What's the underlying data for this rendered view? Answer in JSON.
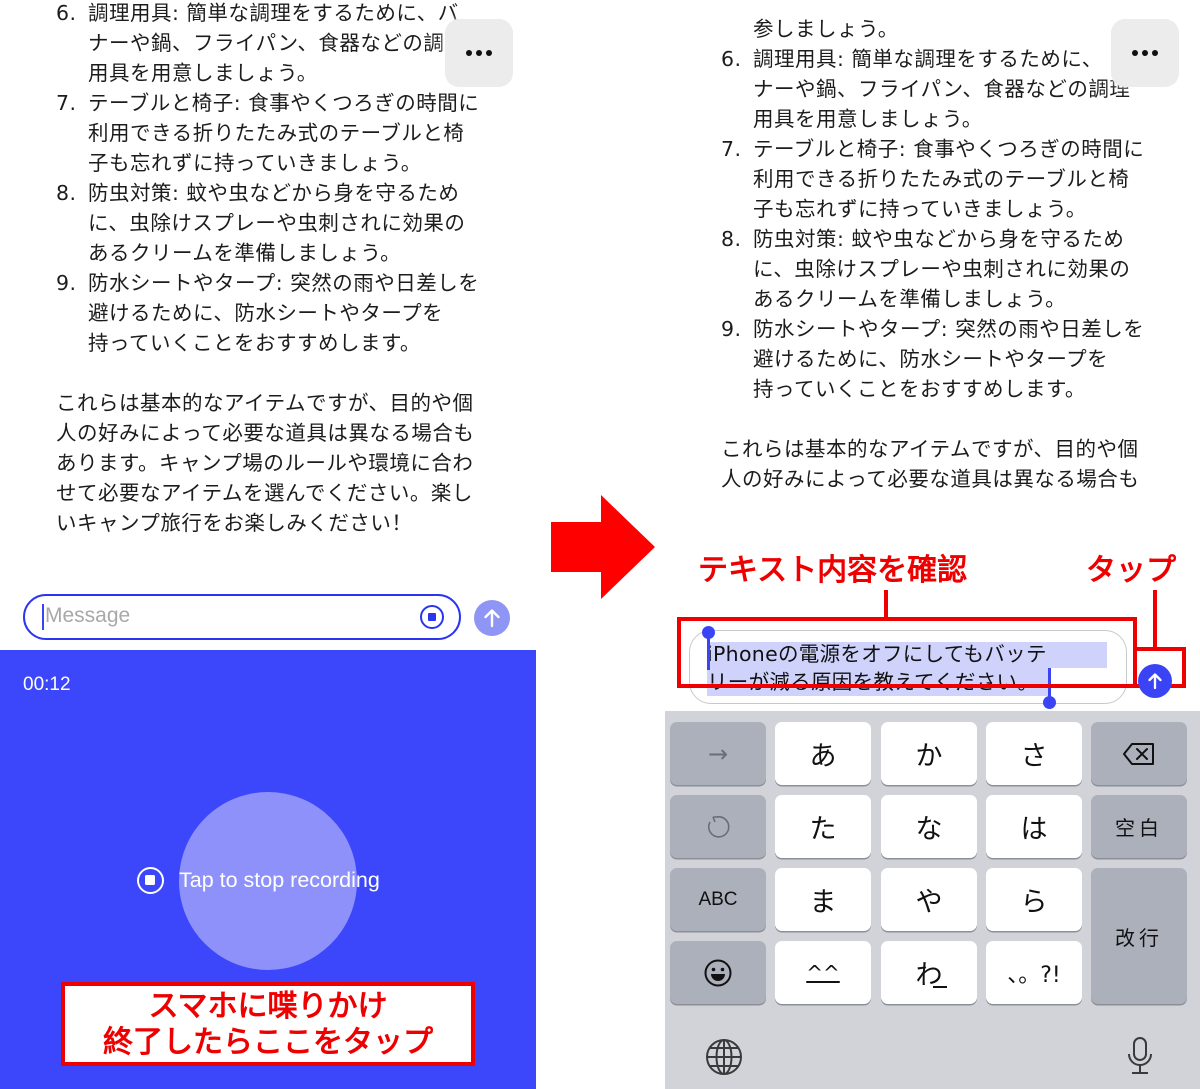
{
  "left": {
    "list_items": [
      {
        "num": "6.",
        "lines": [
          "調理用具: 簡単な調理をするために、バ",
          "ナーや鍋、フライパン、食器などの調",
          "用具を用意しましょう。"
        ]
      },
      {
        "num": "7.",
        "lines": [
          "テーブルと椅子: 食事やくつろぎの時間に",
          "利用できる折りたたみ式のテーブルと椅",
          "子も忘れずに持っていきましょう。"
        ]
      },
      {
        "num": "8.",
        "lines": [
          "防虫対策: 蚊や虫などから身を守るため",
          "に、虫除けスプレーや虫刺されに効果の",
          "あるクリームを準備しましょう。"
        ]
      },
      {
        "num": "9.",
        "lines": [
          "防水シートやタープ: 突然の雨や日差しを",
          "避けるために、防水シートやタープを",
          "持っていくことをおすすめします。"
        ]
      }
    ],
    "closing_lines": [
      "これらは基本的なアイテムですが、目的や個",
      "人の好みによって必要な道具は異なる場合も",
      "あります。キャンプ場のルールや環境に合わ",
      "せて必要なアイテムを選んでください。楽し",
      "いキャンプ旅行をお楽しみください！"
    ],
    "composer": {
      "placeholder": "Message"
    },
    "recording": {
      "timer": "00:12",
      "label": "Tap to stop recording"
    },
    "annotation": {
      "line1": "スマホに喋りかけ",
      "line2": "終了したらここをタップ"
    }
  },
  "right": {
    "top_line": "参しましょう。",
    "list_items": [
      {
        "num": "6.",
        "lines": [
          "調理用具: 簡単な調理をするために、",
          "ナーや鍋、フライパン、食器などの調理",
          "用具を用意しましょう。"
        ]
      },
      {
        "num": "7.",
        "lines": [
          "テーブルと椅子: 食事やくつろぎの時間に",
          "利用できる折りたたみ式のテーブルと椅",
          "子も忘れずに持っていきましょう。"
        ]
      },
      {
        "num": "8.",
        "lines": [
          "防虫対策: 蚊や虫などから身を守るため",
          "に、虫除けスプレーや虫刺されに効果の",
          "あるクリームを準備しましょう。"
        ]
      },
      {
        "num": "9.",
        "lines": [
          "防水シートやタープ: 突然の雨や日差しを",
          "避けるために、防水シートやタープを",
          "持っていくことをおすすめします。"
        ]
      }
    ],
    "closing_lines": [
      "これらは基本的なアイテムですが、目的や個",
      "人の好みによって必要な道具は異なる場合も"
    ],
    "annotation_confirm": "テキスト内容を確認",
    "annotation_tap": "タップ",
    "composer": {
      "line1": "iPhoneの電源をオフにしてもバッテ",
      "line2": "リーが減る原因を教えてください。"
    },
    "keyboard": {
      "next": "→",
      "a": "あ",
      "ka": "か",
      "sa": "さ",
      "undo": "↺",
      "ta": "た",
      "na": "な",
      "ha": "は",
      "space": "空白",
      "abc": "ABC",
      "ma": "ま",
      "ya": "や",
      "ra": "ら",
      "return": "改行",
      "emoji": "☺",
      "kaomoji": "^^",
      "wa": "わ",
      "punct": "、。?!"
    }
  },
  "colors": {
    "accent_blue": "#3c46fb",
    "annotation_red": "#ee0000"
  }
}
